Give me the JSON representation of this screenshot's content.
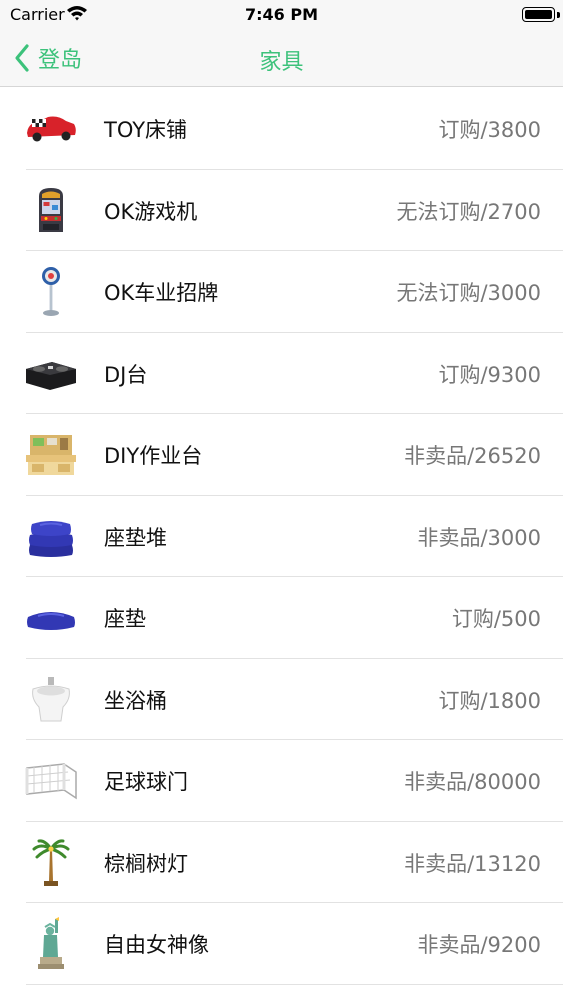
{
  "status_bar": {
    "carrier": "Carrier",
    "time": "7:46 PM"
  },
  "nav": {
    "back_label": "登岛",
    "title": "家具",
    "accent": "#3cc27b"
  },
  "items": [
    {
      "name": "TOY床铺",
      "price": "订购/3800",
      "icon": "toy-car-bed-icon"
    },
    {
      "name": "OK游戏机",
      "price": "无法订购/2700",
      "icon": "arcade-machine-icon"
    },
    {
      "name": "OK车业招牌",
      "price": "无法订购/3000",
      "icon": "shop-sign-icon"
    },
    {
      "name": "DJ台",
      "price": "订购/9300",
      "icon": "dj-booth-icon"
    },
    {
      "name": "DIY作业台",
      "price": "非卖品/26520",
      "icon": "diy-workbench-icon"
    },
    {
      "name": "座垫堆",
      "price": "非卖品/3000",
      "icon": "cushion-stack-icon"
    },
    {
      "name": "座垫",
      "price": "订购/500",
      "icon": "cushion-icon"
    },
    {
      "name": "坐浴桶",
      "price": "订购/1800",
      "icon": "bidet-icon"
    },
    {
      "name": "足球球门",
      "price": "非卖品/80000",
      "icon": "soccer-goal-icon"
    },
    {
      "name": "棕榈树灯",
      "price": "非卖品/13120",
      "icon": "palm-tree-lamp-icon"
    },
    {
      "name": "自由女神像",
      "price": "非卖品/9200",
      "icon": "statue-of-liberty-icon"
    }
  ]
}
